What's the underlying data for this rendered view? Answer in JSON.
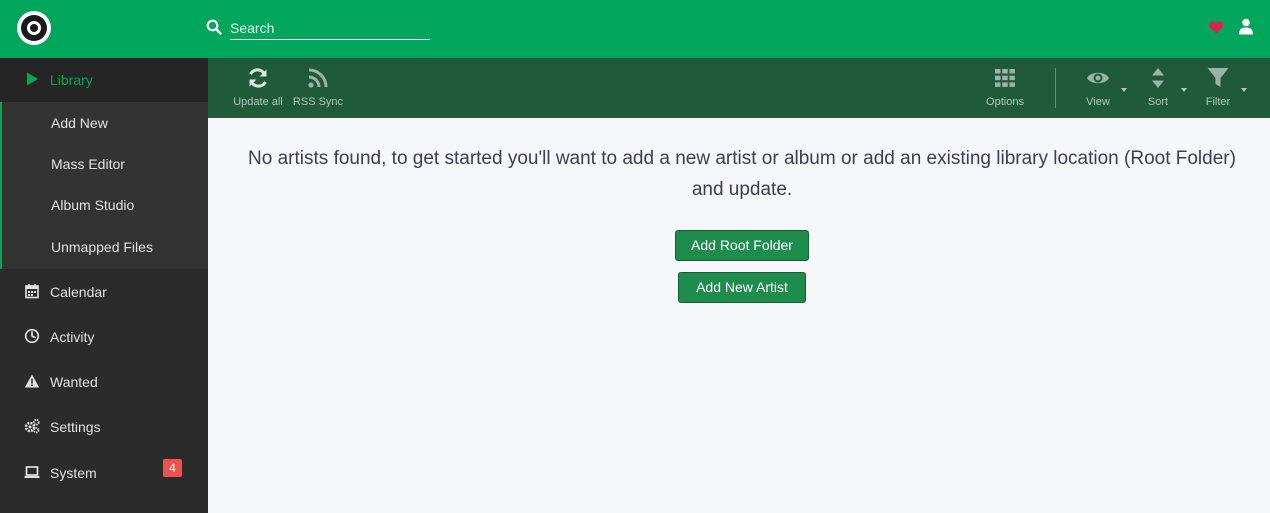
{
  "header": {
    "logo": "lidarr-logo",
    "search_icon": "search-icon",
    "search_placeholder": "Search",
    "donate_icon": "heart-icon",
    "profile_icon": "user-icon",
    "colors": {
      "header_bg": "#00a65b",
      "heart": "#e3204a"
    }
  },
  "sidebar": {
    "library": {
      "label": "Library",
      "icon": "play-icon"
    },
    "library_sub": [
      {
        "label": "Add New"
      },
      {
        "label": "Mass Editor"
      },
      {
        "label": "Album Studio"
      },
      {
        "label": "Unmapped Files"
      }
    ],
    "items": [
      {
        "label": "Calendar",
        "icon": "calendar-icon"
      },
      {
        "label": "Activity",
        "icon": "clock-icon"
      },
      {
        "label": "Wanted",
        "icon": "warning-icon"
      },
      {
        "label": "Settings",
        "icon": "cogs-icon"
      },
      {
        "label": "System",
        "icon": "laptop-icon",
        "badge": "4"
      }
    ],
    "colors": {
      "bg": "#2b2b2b",
      "active": "#00a65b",
      "badge": "#f05050"
    }
  },
  "toolbar": {
    "update_all": "Update all",
    "rss_sync": "RSS Sync",
    "options": "Options",
    "view": "View",
    "sort": "Sort",
    "filter": "Filter",
    "colors": {
      "bg": "#1f5a3a"
    }
  },
  "main": {
    "empty_message": "No artists found, to get started you'll want to add a new artist or album or add an existing library location (Root Folder) and update.",
    "add_root_folder": "Add Root Folder",
    "add_new_artist": "Add New Artist",
    "colors": {
      "button": "#1e8c4c"
    }
  }
}
